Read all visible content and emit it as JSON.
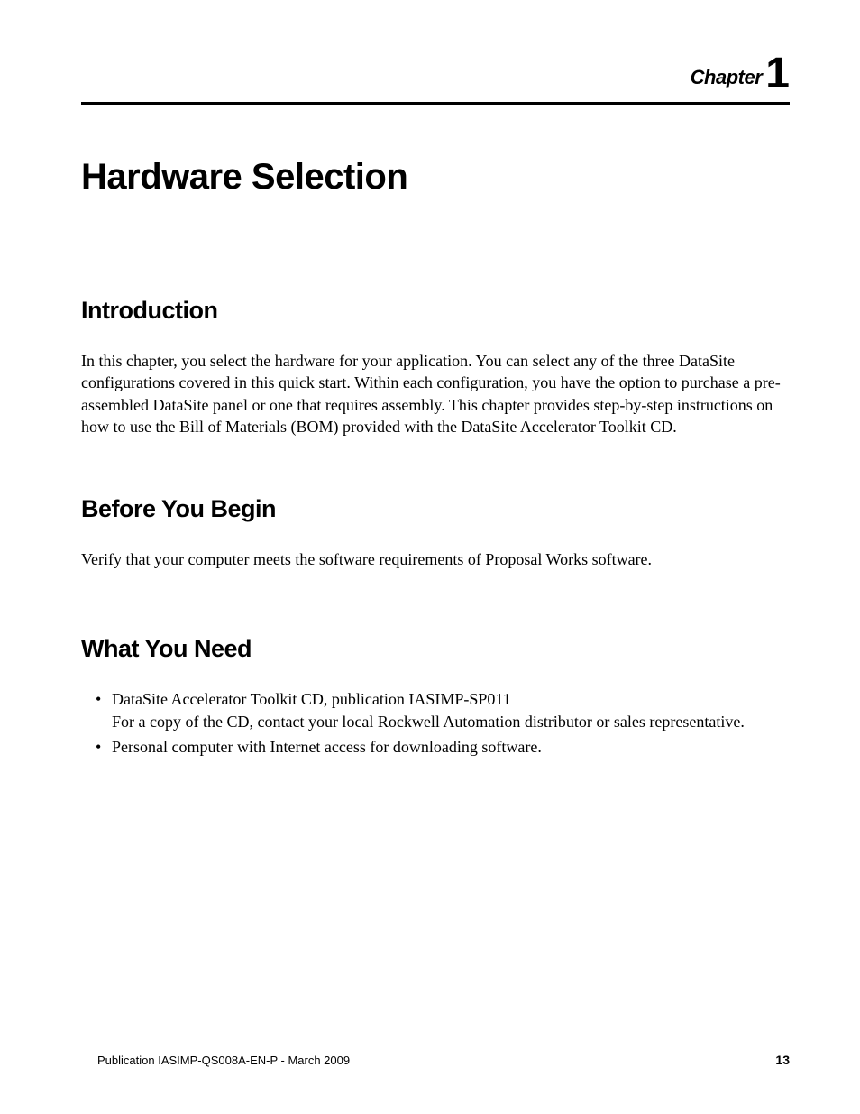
{
  "header": {
    "chapter_label": "Chapter",
    "chapter_number": "1"
  },
  "title": "Hardware Selection",
  "sections": {
    "intro": {
      "heading": "Introduction",
      "body": "In this chapter, you select the hardware for your application. You can select any of the three DataSite configurations covered in this quick start. Within each configuration, you have the option to purchase a pre-assembled DataSite panel or one that requires assembly. This chapter provides step-by-step instructions on how to use the Bill of Materials (BOM) provided with the DataSite Accelerator Toolkit CD."
    },
    "before": {
      "heading": "Before You Begin",
      "body": "Verify that your computer meets the software requirements of Proposal Works software."
    },
    "need": {
      "heading": "What You Need",
      "bullets": [
        {
          "text_prefix": "DataSite Accelerator Toolkit CD, publication ",
          "code": "IASIMP-SP011",
          "text_suffix": "For a copy of the CD, contact your local Rockwell Automation distributor or sales representative."
        },
        {
          "text_prefix": "Personal computer with Internet access for downloading software.",
          "code": "",
          "text_suffix": ""
        }
      ]
    }
  },
  "footer": {
    "publication": "Publication IASIMP-QS008A-EN-P - March 2009",
    "page": "13"
  }
}
